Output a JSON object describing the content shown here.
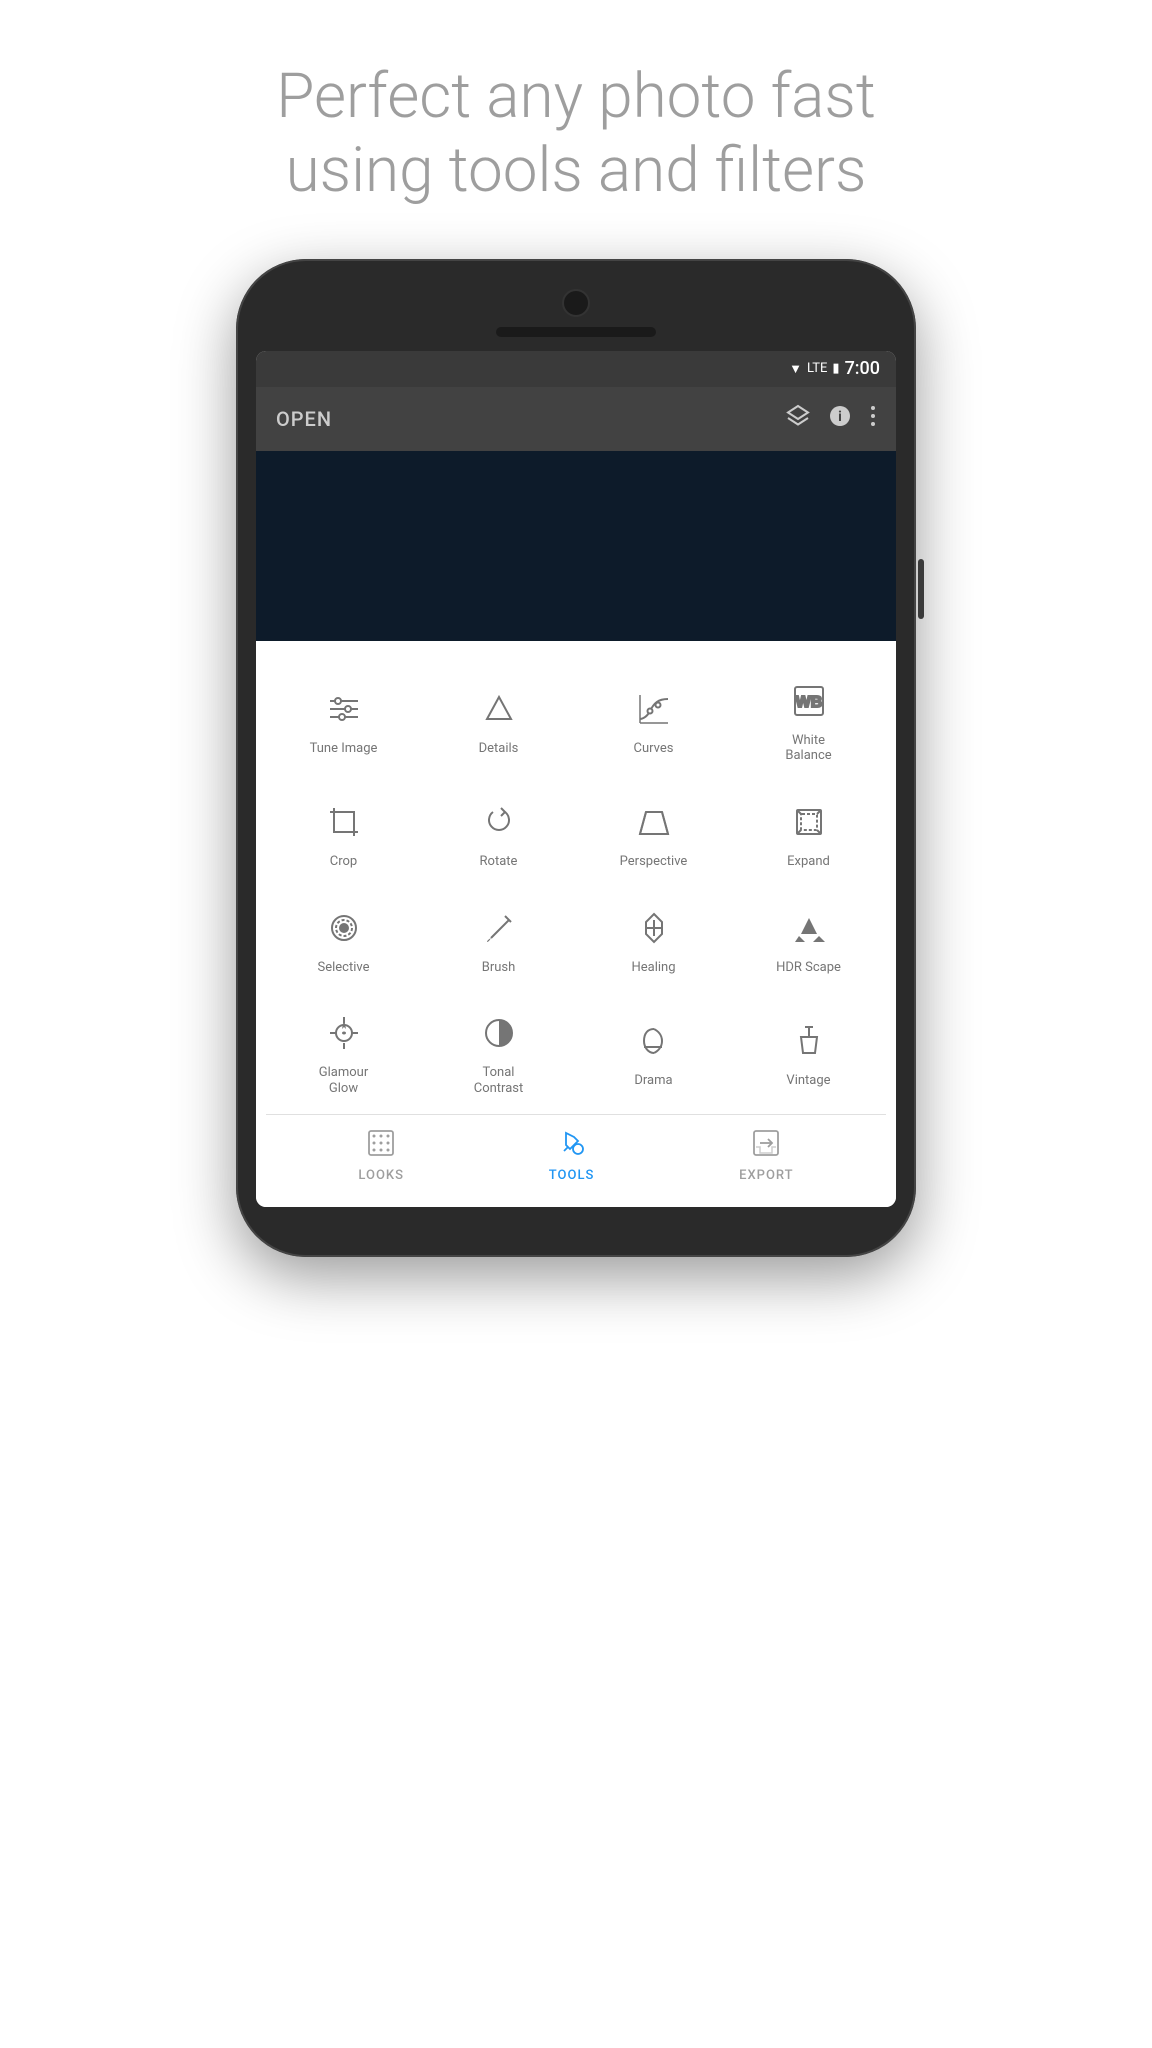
{
  "headline": {
    "line1": "Perfect any photo fast",
    "line2": "using tools and filters"
  },
  "statusBar": {
    "time": "7:00",
    "wifi": "▼",
    "lte": "LTE",
    "battery": "🔋"
  },
  "header": {
    "openLabel": "OPEN",
    "icons": [
      "layers",
      "info",
      "more"
    ]
  },
  "tools": [
    {
      "id": "tune-image",
      "label": "Tune Image",
      "icon": "tune"
    },
    {
      "id": "details",
      "label": "Details",
      "icon": "details"
    },
    {
      "id": "curves",
      "label": "Curves",
      "icon": "curves"
    },
    {
      "id": "white-balance",
      "label": "White Balance",
      "icon": "wb"
    },
    {
      "id": "crop",
      "label": "Crop",
      "icon": "crop"
    },
    {
      "id": "rotate",
      "label": "Rotate",
      "icon": "rotate"
    },
    {
      "id": "perspective",
      "label": "Perspective",
      "icon": "perspective"
    },
    {
      "id": "expand",
      "label": "Expand",
      "icon": "expand"
    },
    {
      "id": "selective",
      "label": "Selective",
      "icon": "selective"
    },
    {
      "id": "brush",
      "label": "Brush",
      "icon": "brush"
    },
    {
      "id": "healing",
      "label": "Healing",
      "icon": "healing"
    },
    {
      "id": "hdr-scape",
      "label": "HDR Scape",
      "icon": "hdr"
    },
    {
      "id": "glamour-glow",
      "label": "Glamour Glow",
      "icon": "glamour"
    },
    {
      "id": "tonal-contrast",
      "label": "Tonal Contrast",
      "icon": "tonal"
    },
    {
      "id": "drama",
      "label": "Drama",
      "icon": "drama"
    },
    {
      "id": "vintage",
      "label": "Vintage",
      "icon": "vintage"
    }
  ],
  "bottomNav": [
    {
      "id": "looks",
      "label": "LOOKS",
      "active": false
    },
    {
      "id": "tools",
      "label": "TOOLS",
      "active": true
    },
    {
      "id": "export",
      "label": "EXPORT",
      "active": false
    }
  ]
}
